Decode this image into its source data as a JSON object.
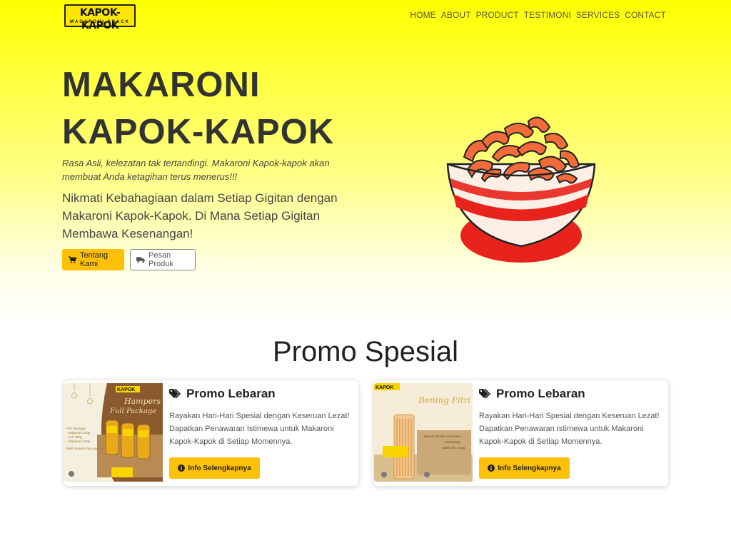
{
  "brand": {
    "logo_text": "KAPOK-KAPOK",
    "logo_sub": "MACARONI SNACK"
  },
  "nav": {
    "items": [
      "HOME",
      "ABOUT",
      "PRODUCT",
      "TESTIMONI",
      "SERVICES",
      "CONTACT"
    ]
  },
  "hero": {
    "title_line1": "MAKARONI",
    "title_line2": "KAPOK-KAPOK",
    "tagline": "Rasa Asli, kelezatan tak tertandingi. Makaroni Kapok-kapok akan membuat Anda ketagihan terus menerus!!!",
    "description": "Nikmati Kebahagiaan dalam Setiap Gigitan dengan Makaroni Kapok-Kapok. Di Mana Setiap Gigitan Membawa Kesenangan!",
    "btn_about": "Tentang Kami",
    "btn_about_icon": "cart-icon",
    "btn_order": "Pesan Produk",
    "btn_order_icon": "truck-icon"
  },
  "promo": {
    "heading": "Promo Spesial",
    "cards": [
      {
        "title": "Promo Lebaran",
        "icon": "tags-icon",
        "text": "Rayakan Hari-Hari Spesial dengan Keseruan Lezat! Dapatkan Penawaran Istimewa untuk Makaroni Kapok-Kapok di Setiap Momennya.",
        "button": "Info Selengkapnya",
        "button_icon": "info-circle-icon",
        "image": {
          "brand": "KAPOK",
          "title1": "Hampers",
          "title2": "Full Package",
          "list_head": "Full Package:",
          "list": [
            "- Makaroni 240g",
            "- Lidi 150g",
            "- Makaroni 240g"
          ],
          "note": "Boleh request rasa apa saja"
        }
      },
      {
        "title": "Promo Lebaran",
        "icon": "tags-icon",
        "text": "Rayakan Hari-Hari Spesial dengan Keseruan Lezat! Dapatkan Penawaran Istimewa untuk Makaroni Kapok-Kapok di Setiap Momennya.",
        "button": "Info Selengkapnya",
        "button_icon": "info-circle-icon",
        "image": {
          "brand": "KAPOK",
          "title1": "Bening Fitri",
          "caption": "Bening Fitri Mix Lidi Varians",
          "weight": "Berat 500g",
          "note": "Boleh mix 2 rasa"
        }
      }
    ]
  },
  "colors": {
    "hero_yellow": "#ffff00",
    "accent": "#ffc107",
    "bowl_red": "#e8231b",
    "macaroni": "#f26b3a"
  }
}
